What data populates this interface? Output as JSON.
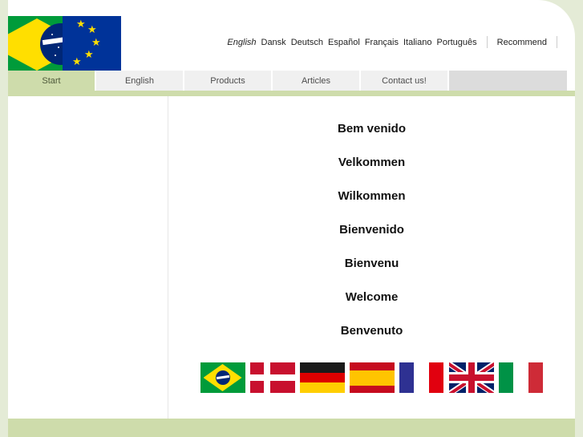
{
  "header": {
    "logo_alt": "Brazil-EU combined flag logo",
    "languages": [
      {
        "label": "English",
        "active": true
      },
      {
        "label": "Dansk",
        "active": false
      },
      {
        "label": "Deutsch",
        "active": false
      },
      {
        "label": "Español",
        "active": false
      },
      {
        "label": "Français",
        "active": false
      },
      {
        "label": "Italiano",
        "active": false
      },
      {
        "label": "Português",
        "active": false
      }
    ],
    "recommend_label": "Recommend"
  },
  "tabs": [
    {
      "label": "Start",
      "active": true
    },
    {
      "label": "English",
      "active": false
    },
    {
      "label": "Products",
      "active": false
    },
    {
      "label": "Articles",
      "active": false
    },
    {
      "label": "Contact us!",
      "active": false
    }
  ],
  "main": {
    "greetings": [
      "Bem venido",
      "Velkommen",
      "Wilkommen",
      "Bienvenido",
      "Bienvenu",
      "Welcome",
      "Benvenuto"
    ],
    "flags": [
      {
        "name": "brazil-flag",
        "title": "Brasil"
      },
      {
        "name": "denmark-flag",
        "title": "Danmark"
      },
      {
        "name": "germany-flag",
        "title": "Deutschland"
      },
      {
        "name": "spain-flag",
        "title": "España"
      },
      {
        "name": "france-flag",
        "title": "France"
      },
      {
        "name": "uk-flag",
        "title": "United Kingdom"
      },
      {
        "name": "italy-flag",
        "title": "Italia"
      }
    ]
  },
  "colors": {
    "page_background": "#e4ebd6",
    "accent_green": "#cedcab",
    "tab_inactive": "#f0f0f0",
    "tab_filler": "#dcdcdc",
    "content_background": "#ffffff"
  }
}
